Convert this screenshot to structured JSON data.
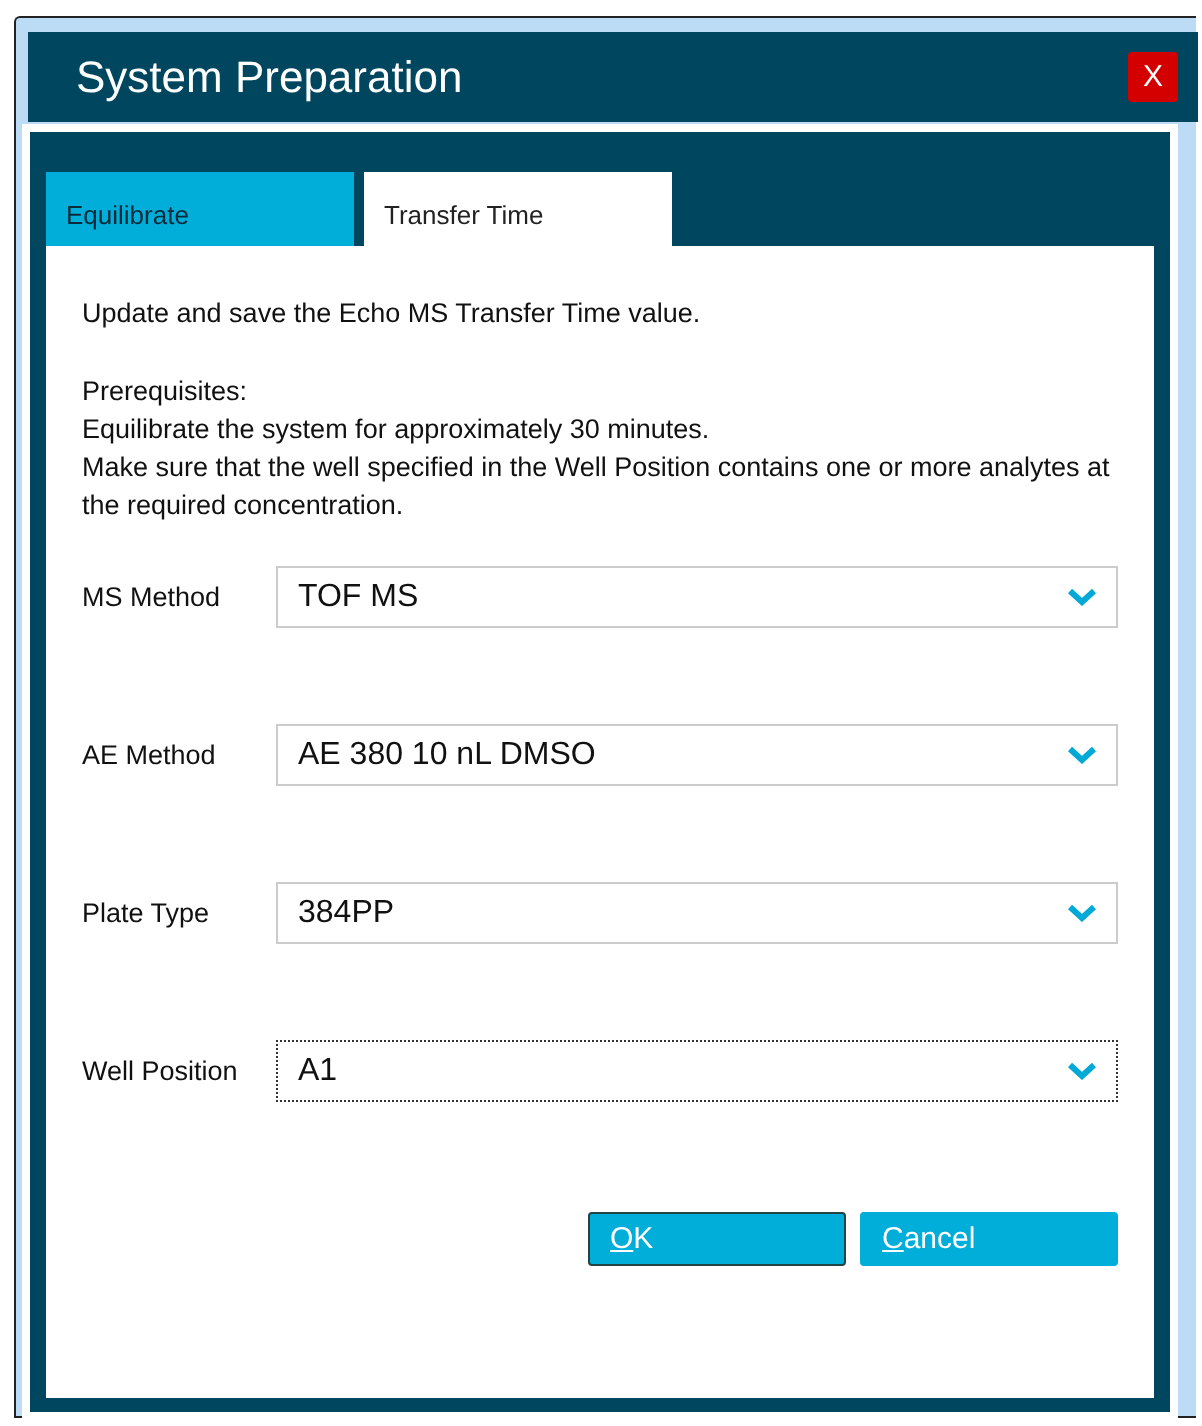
{
  "window": {
    "title": "System Preparation",
    "close": "X"
  },
  "tabs": [
    {
      "label": "Equilibrate",
      "selected": false
    },
    {
      "label": "Transfer Time",
      "selected": true
    }
  ],
  "intro": "Update and save the Echo MS Transfer Time value.",
  "prerequisites": [
    "Prerequisites:",
    "Equilibrate the system for approximately 30 minutes.",
    "Make sure that the well specified in the Well Position contains one or more analytes at the required concentration."
  ],
  "fields": [
    {
      "label": "MS Method",
      "value": "TOF MS",
      "focused": false
    },
    {
      "label": "AE Method",
      "value": "AE 380 10 nL DMSO",
      "focused": false
    },
    {
      "label": "Plate Type",
      "value": "384PP",
      "focused": false
    },
    {
      "label": "Well Position",
      "value": "A1",
      "focused": true
    }
  ],
  "buttons": [
    {
      "label": "OK",
      "focused": true
    },
    {
      "label": "Cancel",
      "focused": false
    }
  ]
}
